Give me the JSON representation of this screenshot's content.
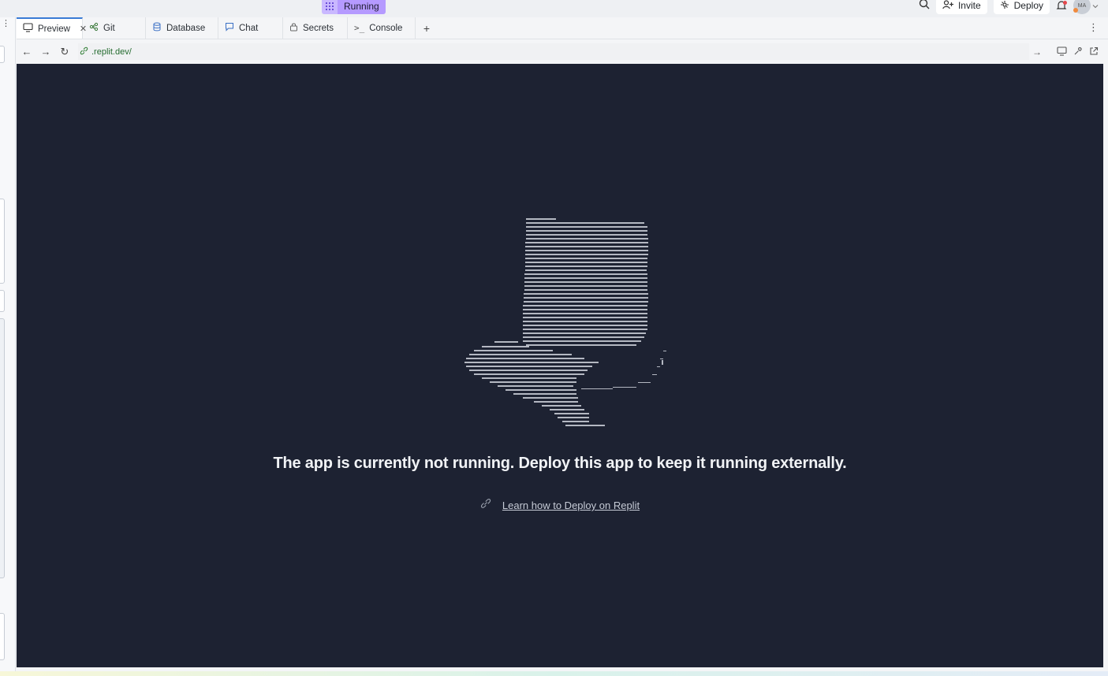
{
  "topbar": {
    "status_label": "Running",
    "invite_label": "Invite",
    "deploy_label": "Deploy",
    "avatar_initials": "MA"
  },
  "tabs": [
    {
      "label": "Preview",
      "icon": "monitor-icon",
      "active": true
    },
    {
      "label": "Git",
      "icon": "git-icon"
    },
    {
      "label": "Database",
      "icon": "database-icon"
    },
    {
      "label": "Chat",
      "icon": "chat-icon"
    },
    {
      "label": "Secrets",
      "icon": "lock-icon"
    },
    {
      "label": "Console",
      "icon": "terminal-icon"
    }
  ],
  "urlbar": {
    "url": ".replit.dev/"
  },
  "preview": {
    "headline": "The app is currently not running. Deploy this app to keep it running externally.",
    "link_text": "Learn how to Deploy on Replit"
  },
  "colors": {
    "preview_bg": "#1d2232",
    "accent_tab": "#3a7bd5",
    "running_pill": "#b59aff",
    "url_text": "#246b2f"
  }
}
